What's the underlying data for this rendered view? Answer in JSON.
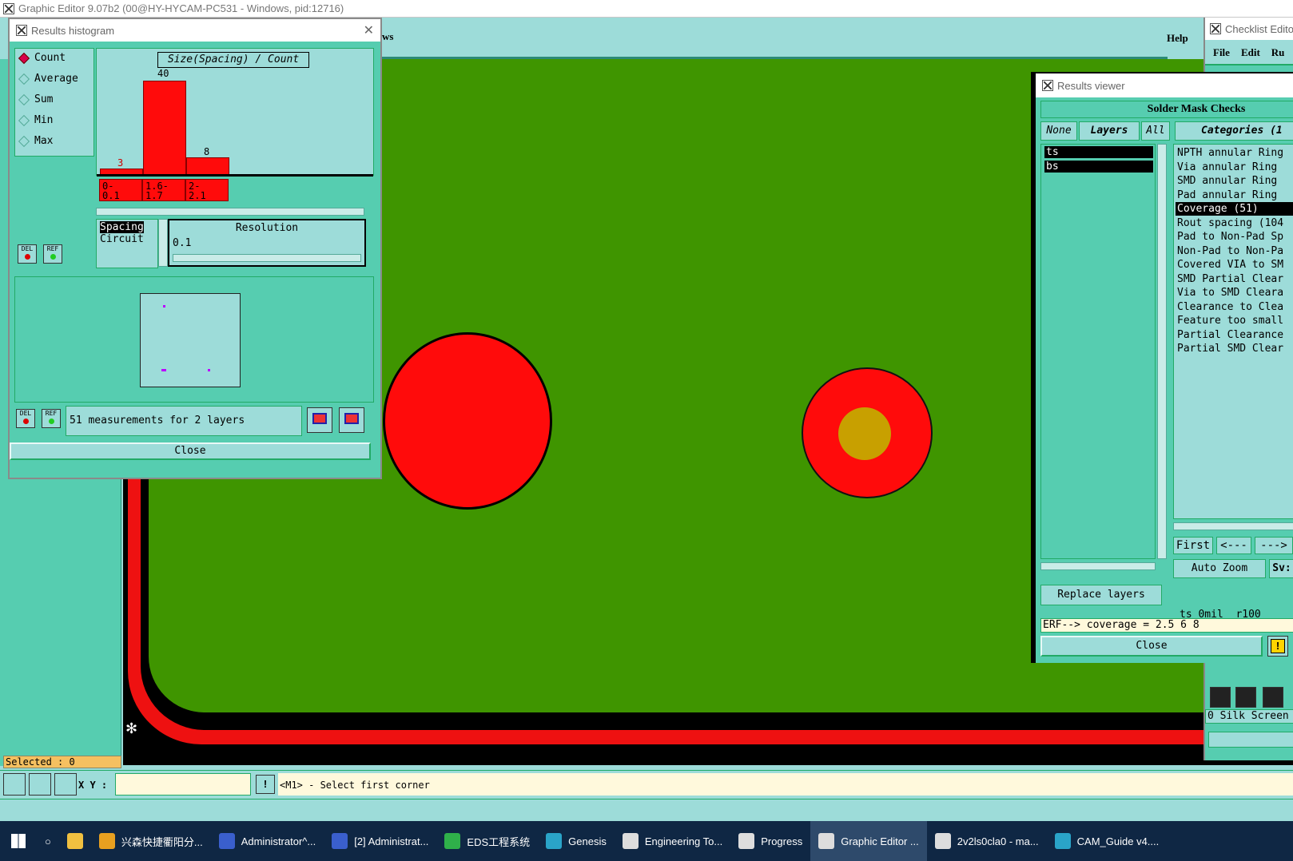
{
  "main_window": {
    "title": "Graphic Editor 9.07b2 (00@HY-HYCAM-PC531 - Windows, pid:12716)",
    "menu_partial": "ws",
    "help": "Help"
  },
  "histogram": {
    "title": "Results histogram",
    "modes": [
      "Count",
      "Average",
      "Sum",
      "Min",
      "Max"
    ],
    "selected_mode": "Count",
    "chart_title": "Size(Spacing) / Count",
    "bins": [
      {
        "label": "0-\n0.1",
        "value": "3"
      },
      {
        "label": "1.6-\n1.7",
        "value": "40"
      },
      {
        "label": "2-\n2.1",
        "value": "8"
      }
    ],
    "attribute_list": [
      "Spacing",
      "Circuit"
    ],
    "resolution_label": "Resolution",
    "resolution_value": "0.1",
    "del_label": "DEL",
    "ref_label": "REF",
    "status": "51 measurements for 2 layers",
    "close": "Close"
  },
  "results_viewer": {
    "title": "Results viewer",
    "header": "Solder Mask Checks",
    "toggles": {
      "none": "None",
      "layers": "Layers",
      "all": "All"
    },
    "categories_header": "Categories (1",
    "layers": [
      "ts",
      "bs"
    ],
    "categories": [
      "NPTH annular Ring",
      "Via annular Ring",
      "SMD annular Ring",
      "Pad annular Ring",
      "Coverage (51)",
      "Rout spacing (104",
      "Pad to Non-Pad Sp",
      "Non-Pad to Non-Pa",
      "Covered VIA to SM",
      "SMD Partial Clear",
      "Via to SMD Cleara",
      "Clearance to Clea",
      "Feature too small",
      "Partial Clearance",
      "Partial SMD Clear"
    ],
    "selected_category": "Coverage (51)",
    "nav": {
      "first": "First",
      "prev": "<---",
      "next": "--->"
    },
    "auto_zoom": "Auto Zoom",
    "sv": "Sv:",
    "replace_layers": "Replace layers",
    "info_line": "ts 0mil  r100",
    "erf_line": "ERF--> coverage = 2.5 6 8",
    "close": "Close"
  },
  "checklist": {
    "title": "Checklist Editor",
    "menu": [
      "File",
      "Edit",
      "Ru"
    ],
    "bottom_row": "0 Silk Screen"
  },
  "status": {
    "selected": "Selected : 0",
    "xy_label": "X Y :",
    "xy_value": "",
    "command_msg": "<M1> - Select first corner"
  },
  "taskbar": [
    {
      "label": "兴森快捷衢阳分...",
      "color": "#e8a020"
    },
    {
      "label": "Administrator^...",
      "color": "#3a5fcd"
    },
    {
      "label": "[2] Administrat...",
      "color": "#3a5fcd"
    },
    {
      "label": "EDS工程系统",
      "color": "#2fb04a"
    },
    {
      "label": "Genesis",
      "color": "#2aa4c8"
    },
    {
      "label": "Engineering To...",
      "color": "#dddddd"
    },
    {
      "label": "Progress",
      "color": "#dddddd"
    },
    {
      "label": "Graphic Editor ...",
      "color": "#dddddd"
    },
    {
      "label": "2v2ls0cla0 - ma...",
      "color": "#dddddd"
    },
    {
      "label": "CAM_Guide v4....",
      "color": "#2aa4c8"
    }
  ],
  "colors": {
    "panel": "#56cdb0",
    "light": "#9ddcd9",
    "board": "#3f9500",
    "pad": "#ff0b0b",
    "hole": "#c8a000"
  }
}
